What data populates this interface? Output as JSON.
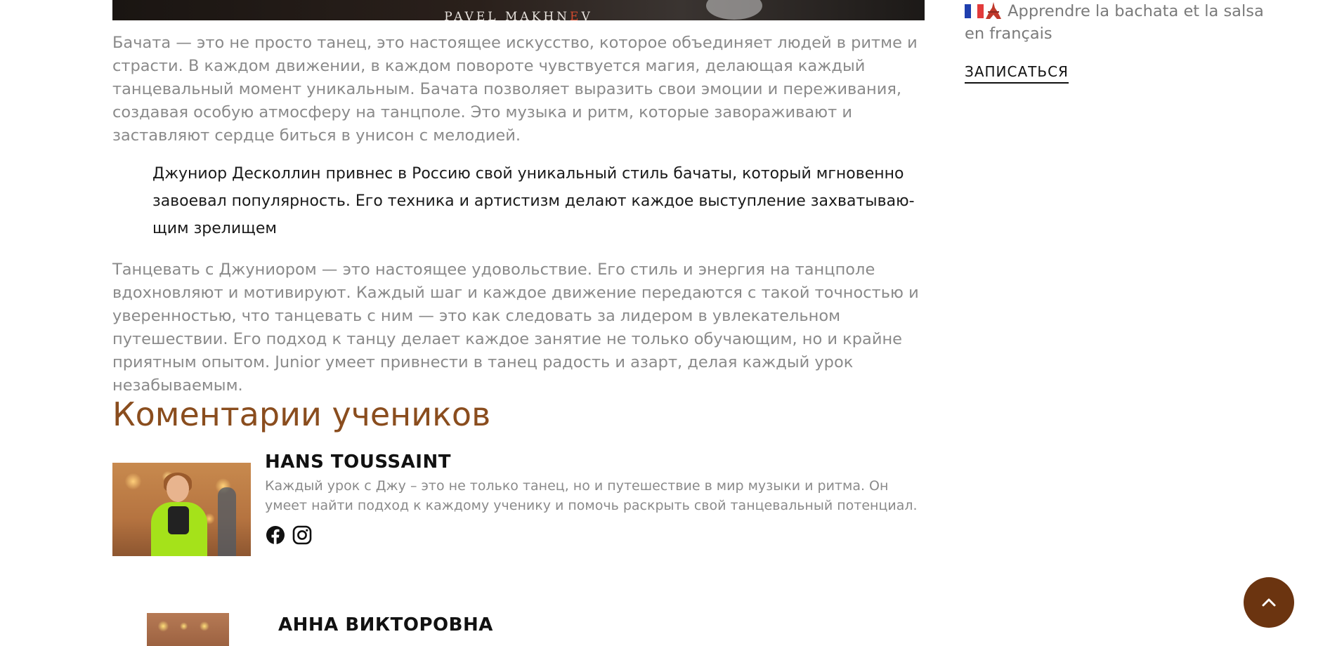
{
  "hero": {
    "watermark_start": "PAVEL MAKHN",
    "watermark_e": "E",
    "watermark_end": "V"
  },
  "article": {
    "paragraph_1": "Бачата — это не просто танец, это настоящее искусство, которое объединяет людей в ритме и стра­сти. В каждом движении, в каждом повороте чувствуется магия, делающая каждый танцевальный момент уникальным. Бачата позволяет выразить свои эмоции и переживания, создавая особую ат­мосферу на танцполе. Это музыка и ритм, которые завораживают и заставляют сердце биться в унисон с мелодией.",
    "quote": "Джуниор Десколлин привнес в Россию свой уникальный стиль бачаты, который мгновенно завоевал популярность. Его техника и артистизм делают каждое выступление захватываю­щим зрелищем",
    "paragraph_2": "Танцевать с Джуниором — это настоящее удовольствие. Его стиль и энергия на танцполе вдохнов­ляют и мотивируют. Каждый шаг и каждое движение передаются с такой точностью и уверенно­стью, что танцевать с ним — это как следовать за лидером в увлекательном путешествии. Его под­ход к танцу делает каждое занятие не только обучающим, но и крайне приятным опытом. Junior умеет привнести в танец радость и азарт, делая каждый урок незабываемым."
  },
  "reviews": {
    "title": "Коментарии учеников",
    "items": [
      {
        "name": "HANS TOUSSAINT",
        "text": "Каждый урок с Джу – это не только танец, но и путешествие в мир музыки и ритма. Он умеет найти подход к каждому ученику и помочь раскрыть свой танцевальный потенциал.",
        "icons": [
          "facebook-icon",
          "instagram-icon"
        ]
      },
      {
        "name": "АННА ВИКТОРОВНА"
      }
    ]
  },
  "sidebar": {
    "french_link": "Apprendre la bachata et la salsa en français",
    "signup_label": "ЗАПИСАТЬСЯ"
  },
  "colors": {
    "heading": "#8a4d1e",
    "body_text": "#8a8a8a",
    "scroll_top_button": "#6b3410",
    "flag_blue": "#1f3fae",
    "flag_red": "#e23b3b"
  },
  "scroll_top": {
    "icon": "chevron-up-icon"
  }
}
